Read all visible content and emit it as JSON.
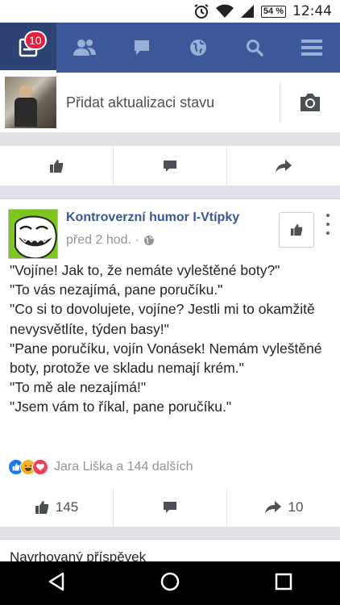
{
  "status_bar": {
    "battery": "54 %",
    "time": "12:44"
  },
  "nav": {
    "notifications_badge": "10"
  },
  "composer": {
    "placeholder": "Přidat aktualizaci stavu"
  },
  "post": {
    "page_name": "Kontroverzní humor I-Vtípky",
    "time": "před 2 hod.",
    "separator": "·",
    "lines": [
      "\"Vojíne! Jak to, že nemáte vyleštěné boty?\"",
      "\"To vás nezajímá, pane poručíku.\"",
      "\"Co si to dovolujete, vojíne? Jestli mi to okamžitě nevysvětlíte, týden basy!\"",
      "\"Pane poručíku, vojín Vonásek! Nemám vyleštěné boty, protože ve skladu nemají krém.\"",
      "\"To mě ale nezajímá!\"",
      "\"Jsem vám to říkal, pane poručíku.\""
    ],
    "reactions_text": "Jara Liška a 144 dalších",
    "like_count": "145",
    "share_count": "10"
  },
  "next_card": {
    "label": "Navrhovaný příspěvek"
  },
  "colors": {
    "fb_blue": "#3b5998",
    "link_blue": "#365899",
    "badge_red": "#e41e3f",
    "like_blue": "#1877f2",
    "love_red": "#f33e58",
    "haha_yellow": "#f7b125"
  }
}
